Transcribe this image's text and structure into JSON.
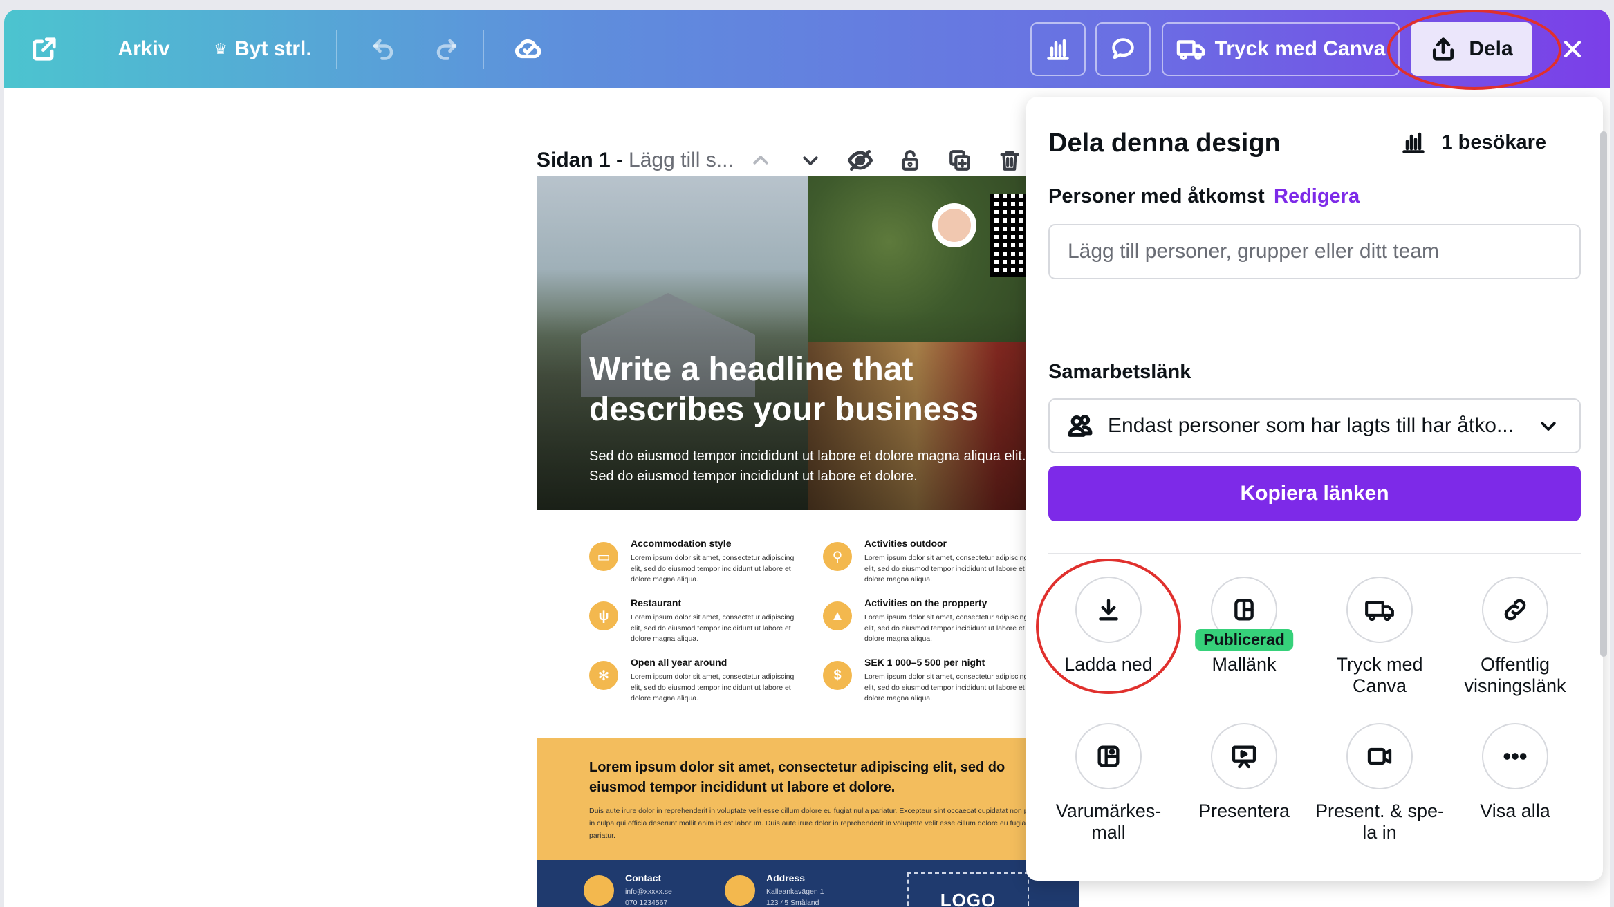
{
  "topbar": {
    "file_label": "Arkiv",
    "resize_label": "Byt strl.",
    "print_label": "Tryck med Canva",
    "share_label": "Dela"
  },
  "page_header": {
    "title": "Sidan 1 -",
    "subtitle": "Lägg till s..."
  },
  "design": {
    "headline": "Write a headline that describes your business",
    "subline": "Sed do eiusmod tempor incididunt ut labore et dolore magna aliqua elit. Sed do eiusmod tempor incididunt ut labore et dolore.",
    "features": [
      {
        "title": "Accommodation style",
        "text": "Lorem ipsum dolor sit amet, consectetur adipiscing elit, sed do eiusmod tempor incididunt ut labore et dolore magna aliqua."
      },
      {
        "title": "Activities outdoor",
        "text": "Lorem ipsum dolor sit amet, consectetur adipiscing elit, sed do eiusmod tempor incididunt ut labore et dolore magna aliqua."
      },
      {
        "title": "Restaurant",
        "text": "Lorem ipsum dolor sit amet, consectetur adipiscing elit, sed do eiusmod tempor incididunt ut labore et dolore magna aliqua."
      },
      {
        "title": "Activities on the propperty",
        "text": "Lorem ipsum dolor sit amet, consectetur adipiscing elit, sed do eiusmod tempor incididunt ut labore et dolore magna aliqua."
      },
      {
        "title": "Open all year around",
        "text": "Lorem ipsum dolor sit amet, consectetur adipiscing elit, sed do eiusmod tempor incididunt ut labore et dolore magna aliqua."
      },
      {
        "title": "SEK 1 000–5 500 per night",
        "text": "Lorem ipsum dolor sit amet, consectetur adipiscing elit, sed do eiusmod tempor incididunt ut labore et dolore magna aliqua."
      }
    ],
    "price_symbol": "$",
    "band_heading": "Lorem ipsum dolor sit amet, consectetur adipiscing elit, sed do eiusmod tempor incididunt ut labore et dolore.",
    "band_text": "Duis aute irure dolor in reprehenderit in voluptate velit esse cillum dolore eu fugiat nulla pariatur. Excepteur sint occaecat cupidatat non proident, sunt in culpa qui officia deserunt mollit anim id est laborum. Duis aute irure dolor in reprehenderit in voluptate velit esse cillum dolore eu fugiat nulla pariatur.",
    "contact_title": "Contact",
    "contact_email": "info@xxxxx.se",
    "contact_phone": "070 1234567",
    "address_title": "Address",
    "address_line1": "Kalleankavägen 1",
    "address_line2": "123 45 Småland",
    "logo_text": "LOGO"
  },
  "share_panel": {
    "title": "Dela denna design",
    "visitors": "1 besökare",
    "access_label": "Personer med åtkomst",
    "edit_link": "Redigera",
    "add_people_placeholder": "Lägg till personer, grupper eller ditt team",
    "collab_label": "Samarbetslänk",
    "collab_value": "Endast personer som har lagts till har åtko...",
    "copy_button": "Kopiera länken",
    "options": [
      {
        "label": "Ladda ned",
        "icon": "download-icon"
      },
      {
        "label": "Mallänk",
        "icon": "template-icon",
        "badge": "Publicerad"
      },
      {
        "label": "Tryck med Canva",
        "icon": "truck-icon"
      },
      {
        "label": "Offentlig visningslänk",
        "icon": "link-icon"
      },
      {
        "label": "Varumärkes-mall",
        "icon": "brand-template-icon"
      },
      {
        "label": "Presentera",
        "icon": "present-icon"
      },
      {
        "label": "Present. & spe-la in",
        "icon": "record-icon"
      },
      {
        "label": "Visa alla",
        "icon": "more-icon"
      }
    ]
  },
  "colors": {
    "accent": "#7d2ae8",
    "badge_green": "#36d17a",
    "highlight_ring": "#e0302d",
    "design_yellow": "#f3bd5d",
    "design_navy": "#1f3a6e"
  }
}
